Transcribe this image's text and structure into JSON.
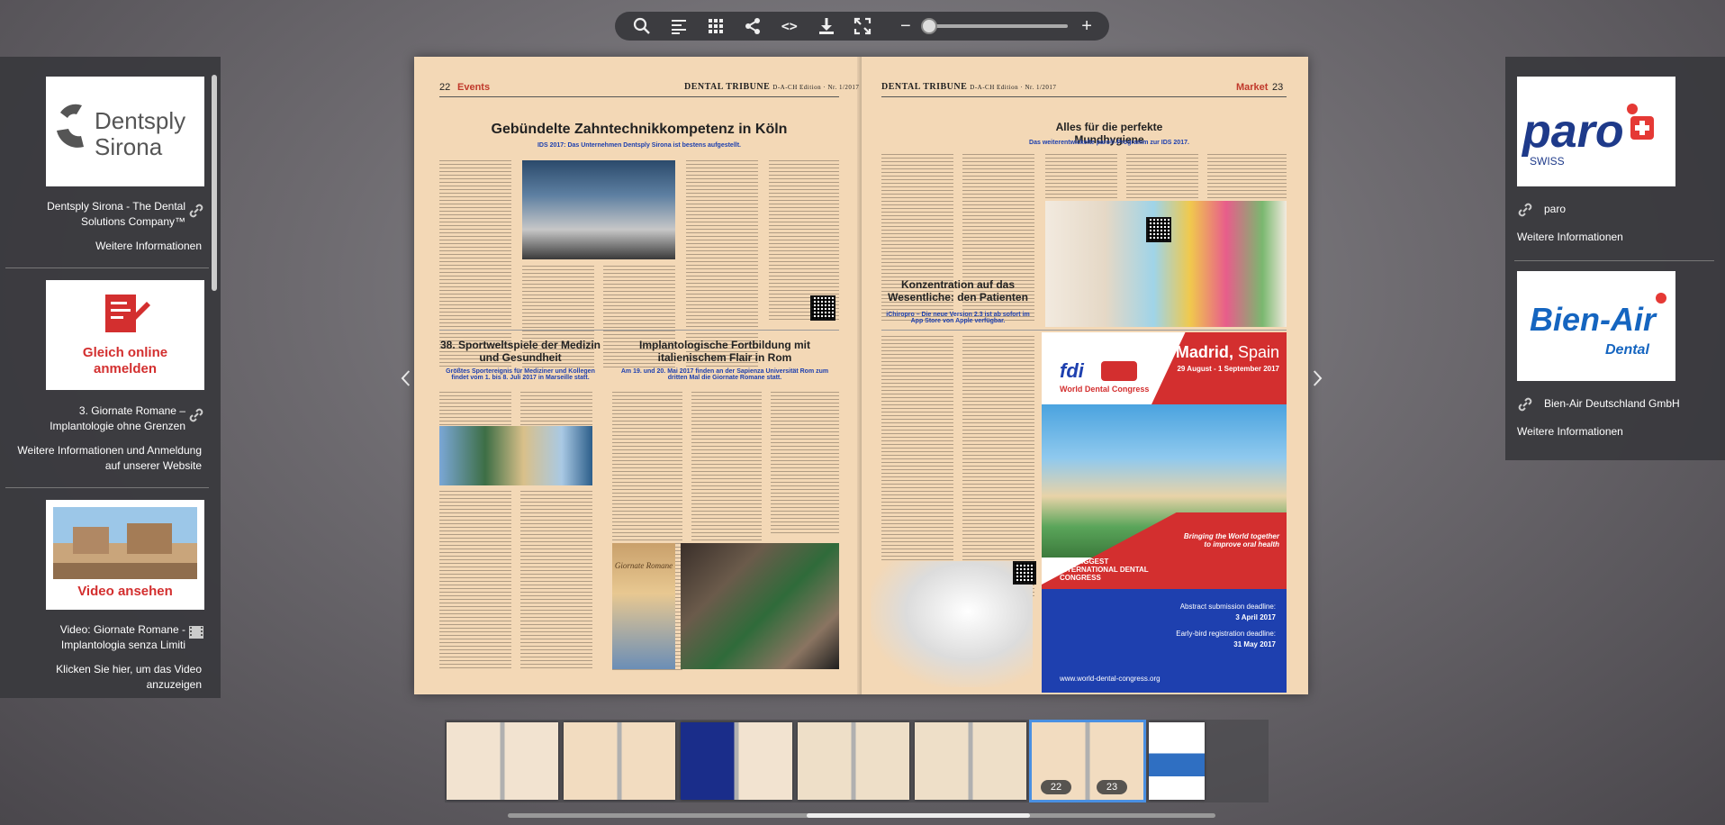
{
  "toolbar": {
    "icons": [
      "search-icon",
      "table-of-contents-icon",
      "grid-icon",
      "share-icon",
      "embed-code-icon",
      "download-icon",
      "fullscreen-icon"
    ],
    "code_label": "<>",
    "zoom_minus": "−",
    "zoom_plus": "+",
    "zoom_level": 0
  },
  "left_panel": {
    "ads": [
      {
        "logo_text": "Dentsply Sirona",
        "title": "Dentsply Sirona - The Dental Solutions Company™",
        "link": "Weitere Informationen"
      },
      {
        "logo_text": "Gleich online anmelden",
        "title": "3. Giornate Romane – Implantologie ohne Grenzen",
        "link": "Weitere Informationen und Anmeldung auf unserer Website"
      },
      {
        "logo_text": "Video ansehen",
        "title": "Video: Giornate Romane - Implantologia senza Limiti",
        "link": "Klicken Sie hier, um das Video anzuzeigen"
      }
    ]
  },
  "right_panel": {
    "ads": [
      {
        "logo_text": "paro",
        "logo_sub": "SWISS",
        "title": "paro",
        "link": "Weitere Informationen"
      },
      {
        "logo_text": "Bien-Air",
        "logo_sub": "Dental",
        "title": "Bien-Air Deutschland GmbH",
        "link": "Weitere Informationen"
      }
    ]
  },
  "left_page": {
    "page_number": "22",
    "section": "Events",
    "brand": "DENTAL TRIBUNE",
    "brand_edition": "D-A-CH Edition · Nr. 1/2017",
    "headline1": "Gebündelte Zahntechnikkompetenz in Köln",
    "sub1": "IDS 2017: Das Unternehmen Dentsply Sirona ist bestens aufgestellt.",
    "headline2": "38. Sportweltspiele der Medizin und Gesundheit",
    "sub2": "Größtes Sportereignis für Mediziner und Kollegen findet vom 1. bis 8. Juli 2017 in Marseille statt.",
    "headline3": "Implantologische Fortbildung mit italienischem Flair in Rom",
    "sub3": "Am 19. und 20. Mai 2017 finden an der Sapienza Universität Rom zum dritten Mal die Giornate Romane statt.",
    "book_title": "Giornate Romane"
  },
  "right_page": {
    "page_number": "23",
    "section": "Market",
    "brand": "DENTAL TRIBUNE",
    "brand_edition": "D-A-CH Edition · Nr. 1/2017",
    "headline1": "Alles für die perfekte Mundhygiene",
    "sub1": "Das weiterentwickelte paro®-Programm zur IDS 2017.",
    "headline2": "Konzentration auf das Wesentliche: den Patienten",
    "sub2": "iChiropro – Die neue Version 2.3 ist ab sofort im App Store von Apple verfügbar.",
    "ad": {
      "city": "Madrid",
      "country": "Spain",
      "dates": "29 August - 1 September 2017",
      "org": "fdi",
      "org_full": "World Dental Congress",
      "tagline": "Bringing the World together to improve oral health",
      "band": "THE BIGGEST INTERNATIONAL DENTAL CONGRESS",
      "deadline1_label": "Abstract submission deadline:",
      "deadline1": "3 April 2017",
      "deadline2_label": "Early-bird registration deadline:",
      "deadline2": "31 May 2017",
      "url": "www.world-dental-congress.org"
    }
  },
  "thumbnails": {
    "active_pages": [
      "22",
      "23"
    ]
  }
}
